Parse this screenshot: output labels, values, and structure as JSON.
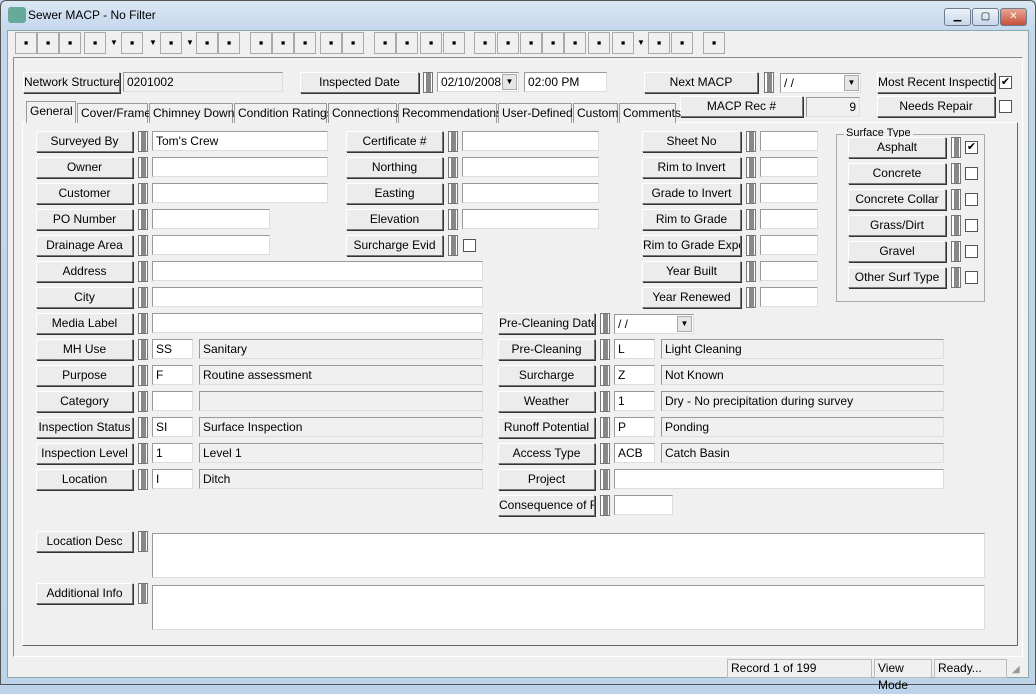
{
  "window": {
    "title": "Sewer MACP - No Filter"
  },
  "toolbar": [
    "screen-icon",
    "print-icon",
    "preview-icon",
    "find-icon",
    "filter-icon",
    "report-icon",
    "properties-icon",
    "export-icon",
    "save-icon",
    "add-record-icon",
    "edit-icon",
    "delete-icon",
    "cut-icon",
    "first-record-icon",
    "previous-record-icon",
    "next-record-icon",
    "last-record-icon",
    "goto-arrow-icon",
    "lightning-icon",
    "hierarchy-icon",
    "network-icon",
    "video-icon",
    "toolbox-icon",
    "globe-search-icon",
    "spreadsheet-icon",
    "book-icon",
    "exit-icon"
  ],
  "header": {
    "network_structure_label": "Network Structure",
    "network_structure": "0201002",
    "inspected_date_label": "Inspected Date",
    "inspected_date": "02/10/2008",
    "inspected_time": "02:00 PM",
    "next_macp_label": "Next MACP",
    "next_macp": " /  /",
    "most_recent_label": "Most Recent Inspection",
    "most_recent": true,
    "macp_rec_label": "MACP Rec #",
    "macp_rec": "9",
    "needs_repair_label": "Needs Repair",
    "needs_repair": false
  },
  "tabs": [
    {
      "label": "General",
      "active": true
    },
    {
      "label": "Cover/Frame"
    },
    {
      "label": "Chimney Down"
    },
    {
      "label": "Condition Ratings"
    },
    {
      "label": "Connections"
    },
    {
      "label": "Recommendations"
    },
    {
      "label": "User-Defined"
    },
    {
      "label": "Custom"
    },
    {
      "label": "Comments"
    }
  ],
  "left_fields": [
    {
      "label": "Surveyed By",
      "value": "Tom's Crew"
    },
    {
      "label": "Owner",
      "value": ""
    },
    {
      "label": "Customer",
      "value": ""
    },
    {
      "label": "PO Number",
      "value": ""
    },
    {
      "label": "Drainage Area",
      "value": ""
    },
    {
      "label": "Address",
      "value": ""
    },
    {
      "label": "City",
      "value": ""
    },
    {
      "label": "Media Label",
      "value": ""
    },
    {
      "label": "MH Use",
      "code": "SS",
      "desc": "Sanitary"
    },
    {
      "label": "Purpose",
      "code": "F",
      "desc": "Routine assessment"
    },
    {
      "label": "Category",
      "code": "",
      "desc": ""
    },
    {
      "label": "Inspection Status",
      "code": "SI",
      "desc": "Surface Inspection"
    },
    {
      "label": "Inspection Level",
      "code": "1",
      "desc": "Level 1"
    },
    {
      "label": "Location",
      "code": "I",
      "desc": "Ditch"
    }
  ],
  "middle_fields": [
    {
      "label": "Certificate #",
      "value": ""
    },
    {
      "label": "Northing",
      "value": ""
    },
    {
      "label": "Easting",
      "value": ""
    },
    {
      "label": "Elevation",
      "value": ""
    },
    {
      "label": "Surcharge Evid",
      "checked": false
    }
  ],
  "right_fields": [
    {
      "label": "Sheet No",
      "value": ""
    },
    {
      "label": "Rim to Invert",
      "value": ""
    },
    {
      "label": "Grade to Invert",
      "value": ""
    },
    {
      "label": "Rim to Grade",
      "value": ""
    },
    {
      "label": "Rim to Grade Exposed",
      "value": ""
    },
    {
      "label": "Year Built",
      "value": ""
    },
    {
      "label": "Year Renewed",
      "value": ""
    }
  ],
  "surface_type": {
    "title": "Surface Type",
    "items": [
      {
        "label": "Asphalt",
        "checked": true
      },
      {
        "label": "Concrete",
        "checked": false
      },
      {
        "label": "Concrete Collar",
        "checked": false
      },
      {
        "label": "Grass/Dirt",
        "checked": false
      },
      {
        "label": "Gravel",
        "checked": false
      },
      {
        "label": "Other Surf Type",
        "checked": false
      }
    ]
  },
  "lower_fields": [
    {
      "label": "Pre-Cleaning Date",
      "date": " /  /"
    },
    {
      "label": "Pre-Cleaning",
      "code": "L",
      "desc": "Light Cleaning"
    },
    {
      "label": "Surcharge",
      "code": "Z",
      "desc": "Not Known"
    },
    {
      "label": "Weather",
      "code": "1",
      "desc": "Dry - No precipitation during survey"
    },
    {
      "label": "Runoff Potential",
      "code": "P",
      "desc": "Ponding"
    },
    {
      "label": "Access Type",
      "code": "ACB",
      "desc": "Catch Basin"
    },
    {
      "label": "Project",
      "value": ""
    },
    {
      "label": "Consequence of Failure",
      "value": ""
    }
  ],
  "memo_fields": [
    {
      "label": "Location Desc",
      "value": ""
    },
    {
      "label": "Additional Info",
      "value": ""
    }
  ],
  "status": {
    "record": "Record 1 of 199",
    "mode": "View Mode",
    "state": "Ready..."
  }
}
